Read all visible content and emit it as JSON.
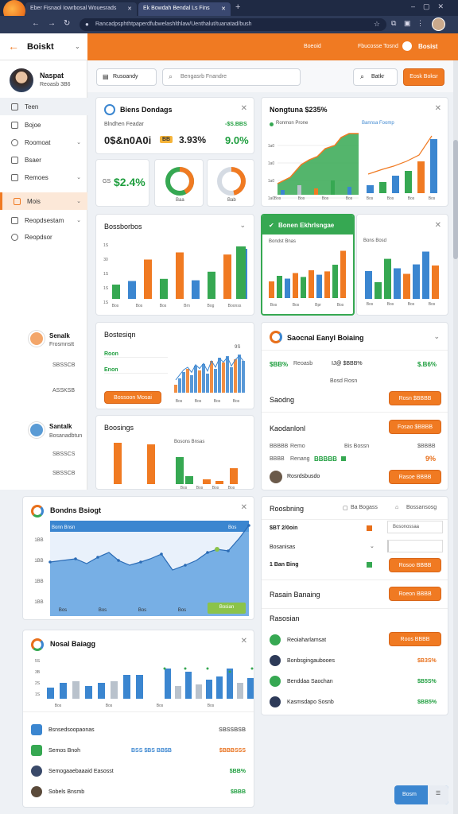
{
  "browser": {
    "tabs": [
      {
        "label": "Eber Fisnaol Iowrbosal Wouesrads"
      },
      {
        "label": "Ek Bowdah Bendal Ls Fins"
      }
    ],
    "address": "Rancadpsphthtpaperdfubwelashlthlaw/Uenthalut/tuanatad/bush"
  },
  "header": {
    "title": "Boiskt",
    "links": [
      "Boeoid",
      "Fbucosse Tosnd"
    ],
    "brand": "Bosist"
  },
  "toolbar": {
    "filter_label": "Rusoandy",
    "search_placeholder": "Bengasrb Fnandre",
    "right_label": "Batkr",
    "primary_btn": "Eosk Boksr"
  },
  "sidebar": {
    "user_name": "Naspat",
    "user_sub": "Reoasb 3B6",
    "items": [
      {
        "label": "Teen"
      },
      {
        "label": "Bojoe"
      },
      {
        "label": "Roomoat"
      },
      {
        "label": "Bsaer"
      },
      {
        "label": "Remoes"
      },
      {
        "label": "Mois"
      },
      {
        "label": "Reopdsestam"
      },
      {
        "label": "Reopdsor"
      }
    ],
    "people": [
      {
        "name": "Senalk",
        "role": "Frosmnstt",
        "v1": "SBSSCB",
        "v2": "ASSKSB"
      },
      {
        "name": "Santalk",
        "role": "Bosanadbtun",
        "v1": "SBSSCS",
        "v2": "SBSSCB"
      }
    ]
  },
  "kpi": {
    "title": "Biens Dondags",
    "sub": "Blndhen Feadar",
    "stat_label": "-$S.BBS",
    "big": "0$&n0A0i",
    "badge": "BB",
    "pct": "3.93%",
    "green": "9.0%",
    "kpi_label": "GS",
    "kpi_value": "$2.4%",
    "d1": "Baa",
    "d2": "Bab"
  },
  "top_chart": {
    "title": "Nongtuna $235%",
    "legend": "Ronmon Prone",
    "ticks": [
      "1a0",
      "1a0",
      "1a0",
      "1a0",
      "1a0"
    ],
    "x": [
      "Bos",
      "Bos",
      "Bos",
      "Bos"
    ],
    "legend2": "Bannsa Foomp"
  },
  "bars1": {
    "title": "Bossborbos",
    "x": [
      "Bos",
      "Bos",
      "Bos",
      "Brn",
      "Bog",
      "Boonss"
    ],
    "y": [
      "1S",
      "30",
      "1S",
      "1S",
      "1S"
    ]
  },
  "green_card": {
    "title": "Bonen Ekhrlsngae",
    "sub": "Bondst Bnas",
    "x": [
      "Bos",
      "Bos",
      "Bpr",
      "Bos"
    ],
    "sub2": "Bons Bosd"
  },
  "small_cards": {
    "a_title": "Bostesiqn",
    "a_rows": [
      "Roon",
      "Enon"
    ],
    "a_btn": "Bossoon Mosai",
    "a_tick": "9S",
    "a_x": [
      "Bos",
      "Bos",
      "Bos",
      "Bos"
    ],
    "b_title": "Boosings",
    "b_legend": "Bosons Bnsas",
    "b_x": [
      "Bos",
      "Bos",
      "Bos",
      "Bos"
    ]
  },
  "social": {
    "title": "Saocnal Eanyl Boiaing",
    "r1a": "$BB%",
    "r1b": "Reoasb",
    "r1c": "IJ@ $BBB%",
    "r1d": "$.B6%",
    "r2": "Bosd Rosn",
    "r3": "Saodng",
    "btn1": "Rosn $BBBB",
    "s2_title": "Kaodanlonl",
    "btn2": "Fosao $BBBB",
    "k1": "BBBBB",
    "k2": "Remo",
    "k3": "Bis Bossn",
    "k4": "$BBBB",
    "k5": "BBBB",
    "k6": "Renang",
    "k7": "BBBBB",
    "k8": "BBBB",
    "k9": "9%",
    "person": "Rosrdsbusdo",
    "btn3": "Rasoe BBBB"
  },
  "area": {
    "title": "Bondns Bsiogt",
    "legend": "Bonn Bnsn",
    "val": "Bos",
    "y": [
      "1BB",
      "1BB",
      "1BB",
      "1BB"
    ],
    "x": [
      "Bos",
      "Bos",
      "Bos",
      "Bos"
    ],
    "btn": "Bosian"
  },
  "activity": {
    "title": "Roosbning",
    "f1": "Ba Bogass",
    "f2": "Bossansosg",
    "r1": "$BT 2/0oin",
    "r1b": "Bosonossaa",
    "r2": "Bosanisas",
    "r3": "1 Ban Bing",
    "btn1": "Rosoo BBBB",
    "s2_title": "Rasain Banaing",
    "btn2": "Roeon BBBB",
    "s3_title": "Rasosian",
    "items": [
      {
        "name": "Reoiaharlamsat",
        "val": "Roos BBBB",
        "btn": true
      },
      {
        "name": "Bonbsgingaubooes",
        "val": "$B3S%"
      },
      {
        "name": "Benddaa Saochan",
        "val": "$B5S%"
      },
      {
        "name": "Kasmsdapo Sosnb",
        "val": "$BB5%"
      }
    ]
  },
  "bottom": {
    "title": "Nosal Baiagg",
    "y": [
      "5S",
      "3B",
      "2S",
      "1S"
    ],
    "x": [
      "Bos",
      "Bos",
      "Bos",
      "Bos"
    ],
    "list": [
      {
        "name": "Bsnsedsoopaonas",
        "val": "SBSSBSB"
      },
      {
        "name": "Semos Bnoh",
        "mid": "BSS $BS BB$B",
        "val": "$BBBSSS"
      },
      {
        "name": "Semogaaebaaaid Easosst",
        "val": "$BB%"
      },
      {
        "name": "Sobels Bnsmb",
        "val": "$BBB"
      }
    ]
  },
  "footer": {
    "btn": "Bosm"
  },
  "colors": {
    "accent": "#f07a22",
    "green": "#36a852",
    "blue": "#3b86d0",
    "sidebar_sel": "#fce8d8"
  }
}
